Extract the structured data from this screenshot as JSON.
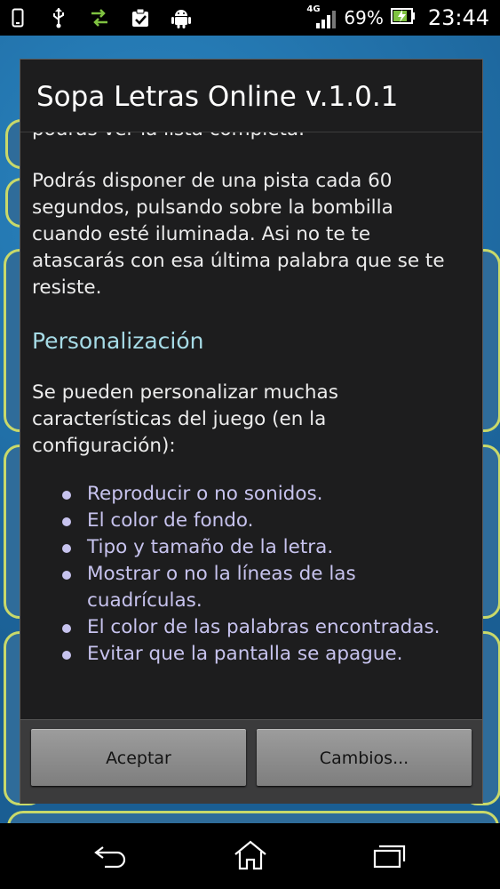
{
  "status_bar": {
    "network_label": "4G",
    "battery_percent": "69%",
    "clock": "23:44"
  },
  "dialog": {
    "title": "Sopa Letras Online v.1.0.1",
    "top_fragment": "podrás ver la lista completa.",
    "hint_paragraph": "Podrás disponer de una pista cada 60 segundos, pulsando sobre la bombilla cuando esté iluminada. Asi no te te atascarás con esa última palabra que se te resiste.",
    "section_title": "Personalización",
    "customize_paragraph": "Se pueden personalizar muchas características del juego (en la configuración):",
    "features": [
      "Reproducir o no sonidos.",
      "El color de fondo.",
      "Tipo y tamaño de la letra.",
      "Mostrar o no la líneas de las cuadrículas.",
      "El color de las palabras encontradas.",
      "Evitar que la pantalla se apague."
    ],
    "accept_label": "Aceptar",
    "changes_label": "Cambios..."
  },
  "icons": {
    "status": [
      "phone-icon",
      "usb-icon",
      "data-transfer-icon",
      "clipboard-icon",
      "android-icon",
      "signal-icon",
      "battery-icon"
    ],
    "nav": [
      "back-icon",
      "home-icon",
      "recent-apps-icon"
    ]
  },
  "colors": {
    "section_title": "#a6dbe6",
    "list_text": "#c7c3ee",
    "dialog_bg": "#1d1d1e",
    "button_bg": "#8d8d8d"
  }
}
